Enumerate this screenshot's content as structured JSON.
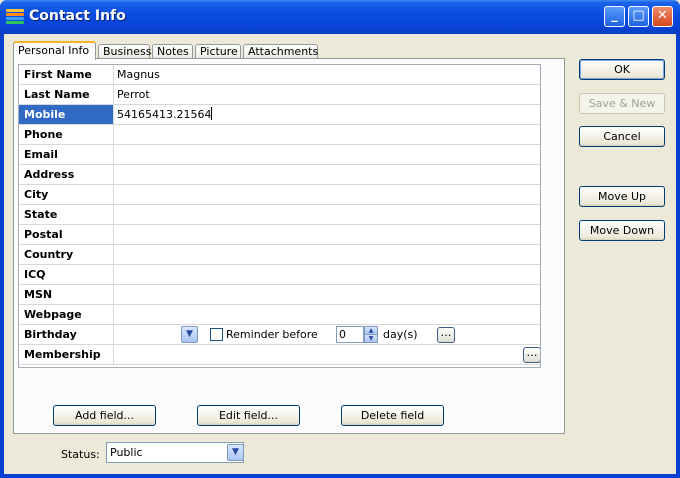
{
  "window": {
    "title": "Contact Info"
  },
  "tabs": [
    "Personal Info",
    "Business",
    "Notes",
    "Picture",
    "Attachments"
  ],
  "fields": [
    {
      "label": "First Name",
      "value": "Magnus"
    },
    {
      "label": "Last Name",
      "value": "Perrot"
    },
    {
      "label": "Mobile",
      "value": "54165413.21564"
    },
    {
      "label": "Phone",
      "value": ""
    },
    {
      "label": "Email",
      "value": ""
    },
    {
      "label": "Address",
      "value": ""
    },
    {
      "label": "City",
      "value": ""
    },
    {
      "label": "State",
      "value": ""
    },
    {
      "label": "Postal",
      "value": ""
    },
    {
      "label": "Country",
      "value": ""
    },
    {
      "label": "ICQ",
      "value": ""
    },
    {
      "label": "MSN",
      "value": ""
    },
    {
      "label": "Webpage",
      "value": ""
    },
    {
      "label": "Birthday",
      "value": ""
    },
    {
      "label": "Membership",
      "value": ""
    }
  ],
  "birthday": {
    "reminder_label": "Reminder before",
    "days_value": "0",
    "days_label": "day(s)"
  },
  "buttons": {
    "ok": "OK",
    "save_new": "Save & New",
    "cancel": "Cancel",
    "move_up": "Move Up",
    "move_down": "Move Down",
    "add_field": "Add field...",
    "edit_field": "Edit field...",
    "delete_field": "Delete field"
  },
  "status": {
    "label": "Status:",
    "value": "Public"
  }
}
